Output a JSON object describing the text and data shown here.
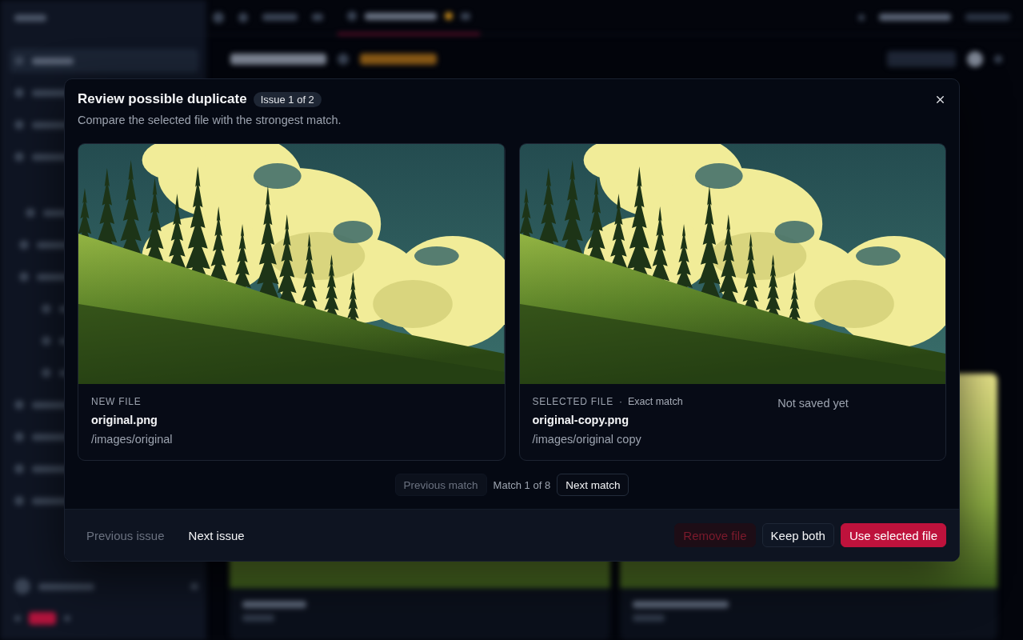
{
  "dialog": {
    "title": "Review possible duplicate",
    "badge": "Issue 1 of 2",
    "subtitle": "Compare the selected file with the strongest match."
  },
  "files": [
    {
      "label": "NEW FILE",
      "name": "original.png",
      "path": "/images/original"
    },
    {
      "label": "SELECTED FILE",
      "separator": "·",
      "match": "Exact match",
      "name": "original-copy.png",
      "path": "/images/original copy",
      "status": "Not saved yet"
    }
  ],
  "match_pager": {
    "previous": {
      "label": "Previous match",
      "disabled": true
    },
    "position": "Match 1 of 8",
    "next": {
      "label": "Next match",
      "disabled": false
    }
  },
  "footer": {
    "navigation": [
      {
        "label": "Previous issue",
        "disabled": true
      },
      {
        "label": "Next issue",
        "disabled": false
      }
    ],
    "actions": [
      {
        "label": "Remove file",
        "kind": "danger",
        "disabled": true
      },
      {
        "label": "Keep both",
        "kind": "secondary",
        "disabled": false
      },
      {
        "label": "Use selected file",
        "kind": "primary",
        "disabled": false
      }
    ]
  }
}
